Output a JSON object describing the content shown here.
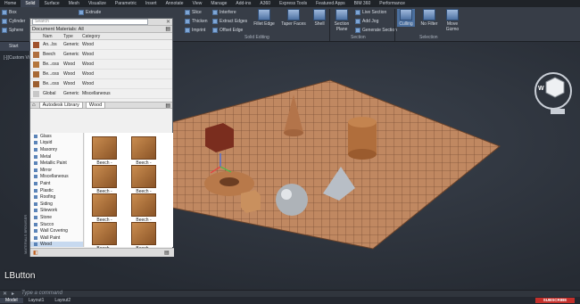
{
  "ribbon_tabs": [
    "Home",
    "Solid",
    "Surface",
    "Mesh",
    "Visualize",
    "Parametric",
    "Insert",
    "Annotate",
    "View",
    "Manage",
    "Add-ins",
    "A360",
    "Express Tools",
    "Featured Apps",
    "BIM 360",
    "Performance"
  ],
  "ribbon_buttons": {
    "box": "Box",
    "cylinder": "Cylinder",
    "sphere": "Sphere",
    "extrude": "Extrude",
    "slice": "Slice",
    "interfere": "Interfere",
    "thicken": "Thicken",
    "extract_edges": "Extract Edges",
    "imprint": "Imprint",
    "offset_edge": "Offset Edge",
    "fillet_edge": "Fillet Edge",
    "taper_faces": "Taper Faces",
    "shell": "Shell",
    "section_plane": "Section Plane",
    "live_section": "Live Section",
    "add_jog": "Add Jog",
    "generate_section": "Generate Section",
    "culling": "Culling",
    "no_filter": "No Filter",
    "move_gizmo": "Move Gizmo"
  },
  "ribbon_panels": {
    "solid_editing": "Solid Editing",
    "section": "Section",
    "selection": "Selection"
  },
  "file_tab": "Start",
  "viewport_label": "[-][Custom View][Realistic]",
  "materials": {
    "search_placeholder": "Search",
    "header": "Document Materials: All",
    "columns": [
      "Nam",
      "Type",
      "Category"
    ],
    "rows": [
      {
        "name": "An...bs",
        "type": "Generic",
        "category": "Wood",
        "color": "#a0522d"
      },
      {
        "name": "Beech",
        "type": "Generic",
        "category": "Wood",
        "color": "#b07040"
      },
      {
        "name": "Be...oss",
        "type": "Wood",
        "category": "Wood",
        "color": "#b5773d"
      },
      {
        "name": "Be...oss",
        "type": "Wood",
        "category": "Wood",
        "color": "#a86a36"
      },
      {
        "name": "Be...oss",
        "type": "Wood",
        "category": "Wood",
        "color": "#9c5f30"
      },
      {
        "name": "Global",
        "type": "Generic",
        "category": "Miscellaneous",
        "color": "#c8c8c8"
      }
    ],
    "library_name": "Autodesk Library",
    "library_folder": "Wood",
    "tree": [
      "Glass",
      "Liquid",
      "Masonry",
      "Metal",
      "Metallic Paint",
      "Mirror",
      "Miscellaneous",
      "Paint",
      "Plastic",
      "Roofing",
      "Siding",
      "Sitework",
      "Stone",
      "Stucco",
      "Wall Covering",
      "Wall Paint",
      "Wood"
    ],
    "tiles": [
      "Beech - Solid...low",
      "Beech - Solid...ized",
      "Beech - Solid...ized",
      "Beech - Solid...ized",
      "Beech - Solid...ized",
      "Beech - Solid...ized",
      "Beech - Solid...ized",
      "Beech - Solid...ized"
    ],
    "side_title": "MATERIALS BROWSER"
  },
  "overlay_text": "LButton",
  "command_placeholder": "Type a command",
  "layout_tabs": [
    "Model",
    "Layout1",
    "Layout2"
  ],
  "navcube": {
    "w": "W"
  },
  "subscribe": "SUBSCRIBE"
}
